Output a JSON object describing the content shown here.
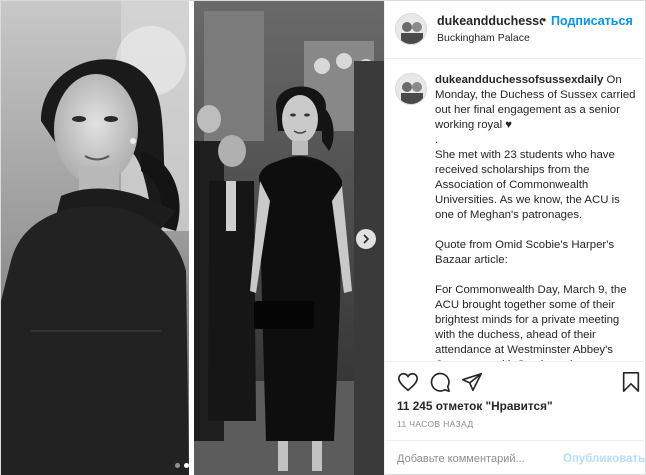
{
  "post": {
    "username": "dukeandduchessofs",
    "follow_label": "Подписаться",
    "separator": "•",
    "location": "Buckingham Palace",
    "caption": {
      "username": "dukeandduchessofsussexdaily",
      "text_1": " On Monday, the Duchess of Sussex carried out her final engagement as a senior working royal ♥",
      "text_2": ".",
      "text_3": "She met with 23 students who have received scholarships from the Association of Commonwealth Universities. As we know, the ACU is one of Meghan's patronages.",
      "text_4": "Quote from Omid Scobie's Harper's Bazaar article:",
      "text_5": "For Commonwealth Day, March 9, the ACU brought together some of their brightest minds for a private meeting with the duchess, ahead of their attendance at Westminster Abbey's Commonwealth Service, where some"
    },
    "likes": "11 245 отметок \"Нравится\"",
    "time_ago": "11 ЧАСОВ НАЗАД",
    "comment_placeholder": "Добавьте комментарий...",
    "publish_label": "Опубликовать",
    "carousel": {
      "total": 2,
      "current": 2
    }
  },
  "icons": {
    "like": "heart-icon",
    "comment": "comment-icon",
    "share": "share-icon",
    "save": "bookmark-icon",
    "next": "chevron-right-icon"
  },
  "colors": {
    "link_blue": "#0095f6",
    "publish_disabled": "#b2dffc",
    "muted": "#8e8e8e",
    "text": "#262626"
  }
}
